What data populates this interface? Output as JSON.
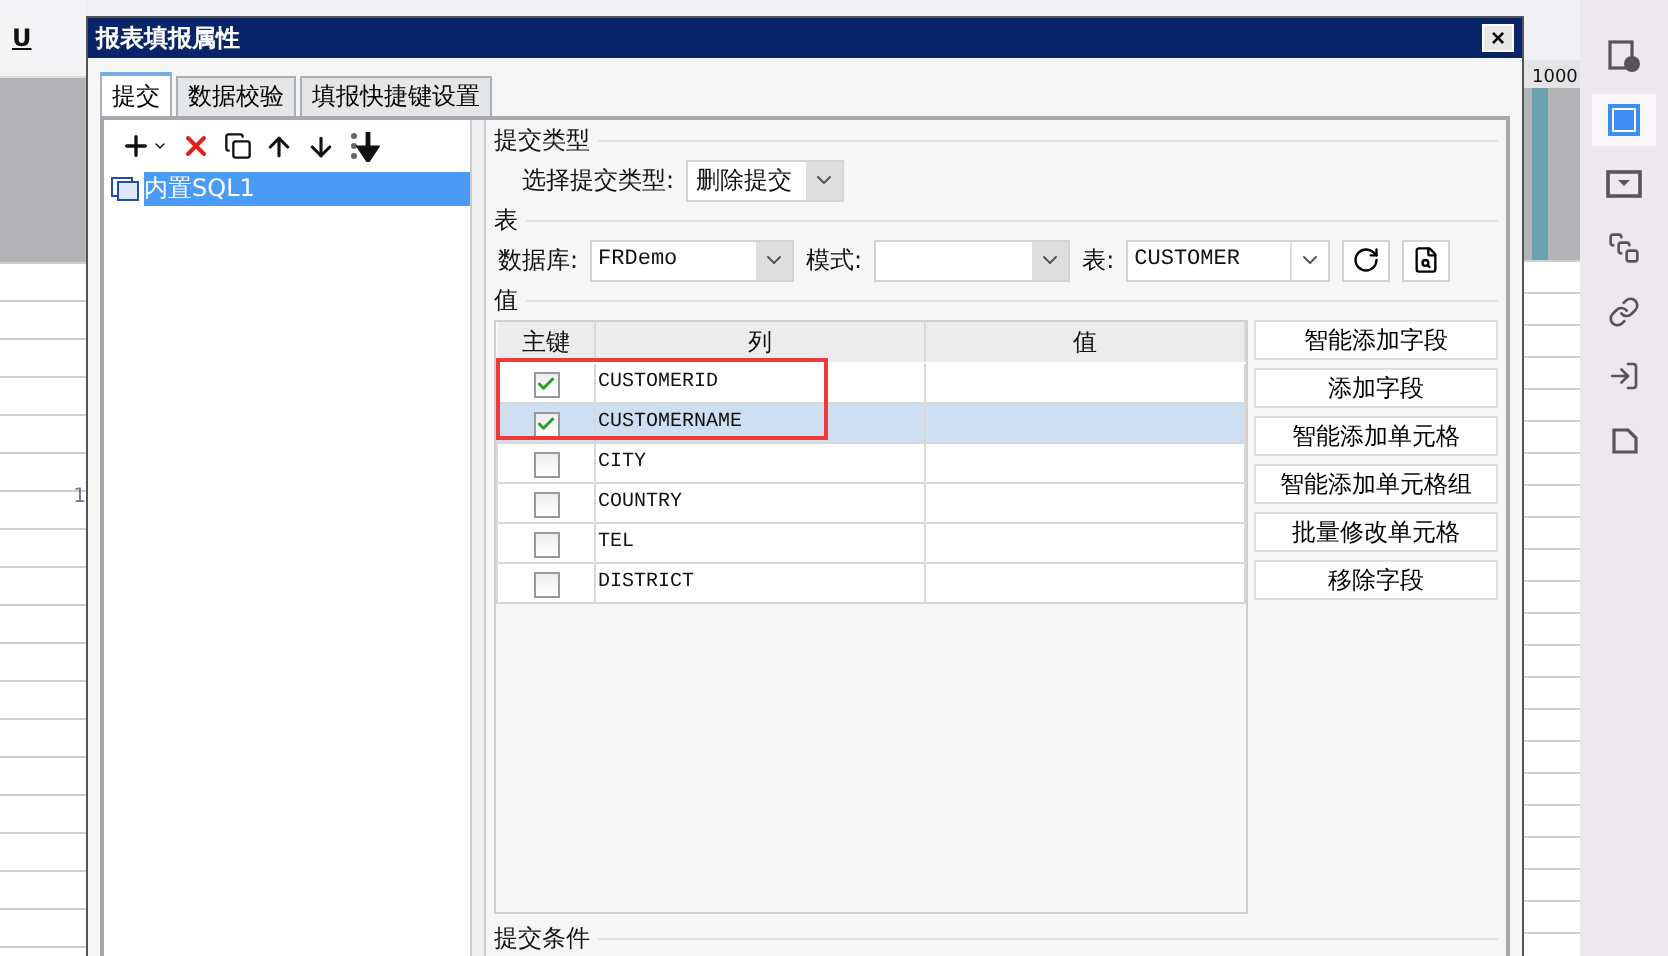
{
  "background": {
    "toolbar_label": "U",
    "ruler_label": "1000",
    "row_number": "1"
  },
  "window": {
    "title": "报表填报属性",
    "close": "×"
  },
  "tabs": [
    {
      "label": "提交",
      "selected": true
    },
    {
      "label": "数据校验",
      "selected": false
    },
    {
      "label": "填报快捷键设置",
      "selected": false
    }
  ],
  "submissions": [
    {
      "label": "内置SQL1",
      "selected": true
    }
  ],
  "submit_type": {
    "heading": "提交类型",
    "label": "选择提交类型:",
    "value": "删除提交"
  },
  "table_section": {
    "heading": "表",
    "database_label": "数据库:",
    "database": "FRDemo",
    "schema_label": "模式:",
    "table_label": "表:",
    "table": "CUSTOMER"
  },
  "values": {
    "heading": "值",
    "columns": [
      "主键",
      "列",
      "值"
    ],
    "rows": [
      {
        "column": "CUSTOMERID",
        "key": true,
        "selected": false
      },
      {
        "column": "CUSTOMERNAME",
        "key": true,
        "selected": true
      },
      {
        "column": "CITY",
        "key": false,
        "selected": false
      },
      {
        "column": "COUNTRY",
        "key": false,
        "selected": false
      },
      {
        "column": "TEL",
        "key": false,
        "selected": false
      },
      {
        "column": "DISTRICT",
        "key": false,
        "selected": false
      }
    ]
  },
  "field_buttons": [
    "智能添加字段",
    "添加字段",
    "智能添加单元格",
    "智能添加单元格组",
    "批量修改单元格",
    "移除字段"
  ],
  "condition": {
    "heading": "提交条件"
  },
  "sidebar": [
    {
      "kind": "table-info",
      "selected": false
    },
    {
      "kind": "frame",
      "selected": true
    },
    {
      "kind": "dropdown",
      "selected": false
    },
    {
      "kind": "layers",
      "selected": false
    },
    {
      "kind": "link",
      "selected": false
    },
    {
      "kind": "import",
      "selected": false
    },
    {
      "kind": "pages",
      "selected": false
    }
  ]
}
